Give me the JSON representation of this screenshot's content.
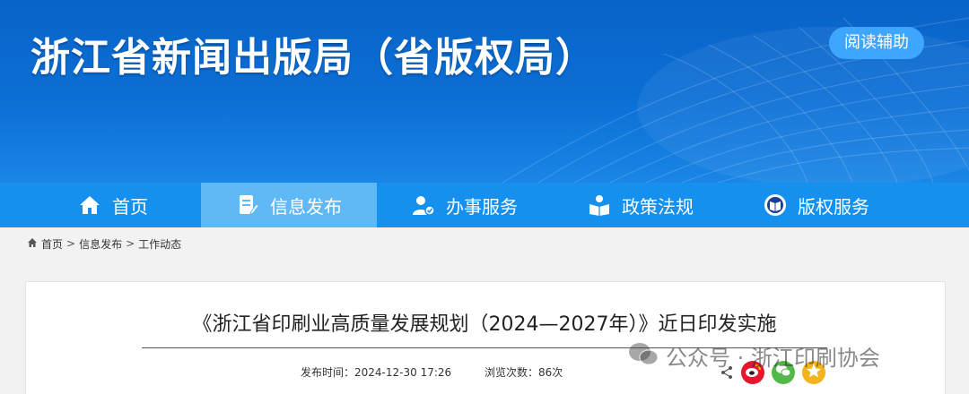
{
  "header": {
    "site_title": "浙江省新闻出版局（省版权局）",
    "assist_label": "阅读辅助"
  },
  "nav": {
    "items": [
      {
        "label": "首页",
        "icon": "home-icon"
      },
      {
        "label": "信息发布",
        "icon": "document-edit-icon",
        "active": true
      },
      {
        "label": "办事服务",
        "icon": "user-service-icon"
      },
      {
        "label": "政策法规",
        "icon": "reading-person-icon"
      },
      {
        "label": "版权服务",
        "icon": "copyright-book-icon"
      }
    ]
  },
  "breadcrumb": {
    "items": [
      "首页",
      "信息发布",
      "工作动态"
    ],
    "separator": ">"
  },
  "article": {
    "title": "《浙江省印刷业高质量发展规划（2024—2027年）》近日印发实施",
    "publish_label": "发布时间：",
    "publish_time": "2024-12-30 17:26",
    "views_label": "浏览次数：",
    "views_count": "86次"
  },
  "share": {
    "icons": [
      "share-icon",
      "weibo-icon",
      "wechat-icon",
      "qzone-icon"
    ]
  },
  "watermark": {
    "text": "公众号 · 浙江印刷协会"
  },
  "colors": {
    "banner": "#0b6fd6",
    "nav": "#1590ee",
    "nav_active": "#5fb9f7",
    "assist_button": "#3ea6ff"
  }
}
